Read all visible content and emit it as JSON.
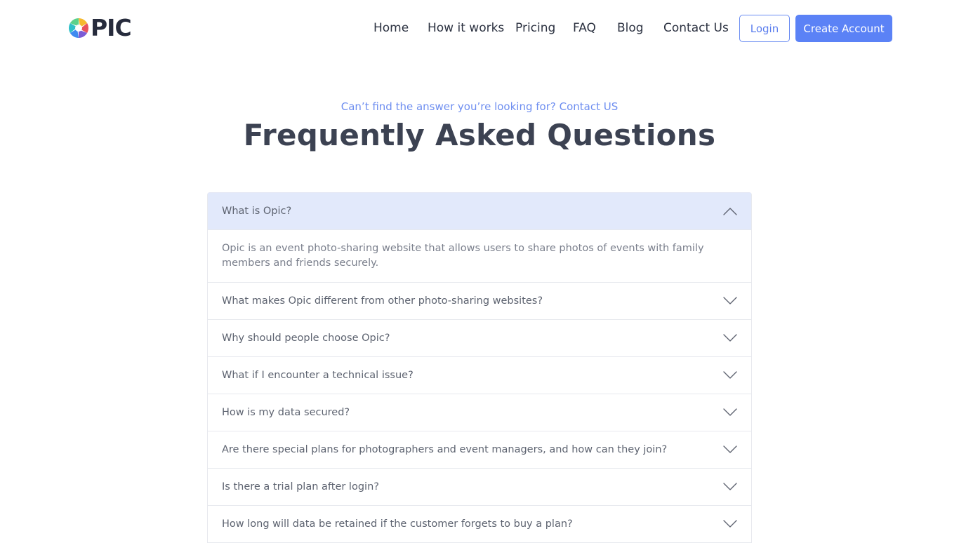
{
  "brand": {
    "logo_text": "PIC",
    "logo_colors": [
      "#f5b82e",
      "#e8505b",
      "#7b5bd6",
      "#3f8af0",
      "#2fc0c8",
      "#5bd18b"
    ]
  },
  "nav": {
    "links": [
      "Home",
      "How it works",
      "Pricing",
      "FAQ",
      "Blog",
      "Contact Us"
    ],
    "login_label": "Login",
    "create_label": "Create Account"
  },
  "hero": {
    "subtitle": "Can’t find the answer you’re looking for? Contact US",
    "title": "Frequently Asked Questions"
  },
  "faq": {
    "items": [
      {
        "question": "What is Opic?",
        "expanded": true,
        "answer": "Opic is an event photo-sharing website that allows users to share photos of events with family members and friends securely."
      },
      {
        "question": "What makes Opic different from other photo-sharing websites?",
        "expanded": false
      },
      {
        "question": "Why should people choose Opic?",
        "expanded": false
      },
      {
        "question": "What if I encounter a technical issue?",
        "expanded": false
      },
      {
        "question": "How is my data secured?",
        "expanded": false
      },
      {
        "question": "Are there special plans for photographers and event managers, and how can they join?",
        "expanded": false
      },
      {
        "question": "Is there a trial plan after login?",
        "expanded": false
      },
      {
        "question": "How long will data be retained if the customer forgets to buy a plan?",
        "expanded": false
      }
    ]
  },
  "colors": {
    "accent": "#5b82f6",
    "title": "#3c4252",
    "open_item_bg": "#e2e9fb"
  },
  "icons": {
    "expanded": "chevron-up-icon",
    "collapsed": "chevron-down-icon"
  }
}
